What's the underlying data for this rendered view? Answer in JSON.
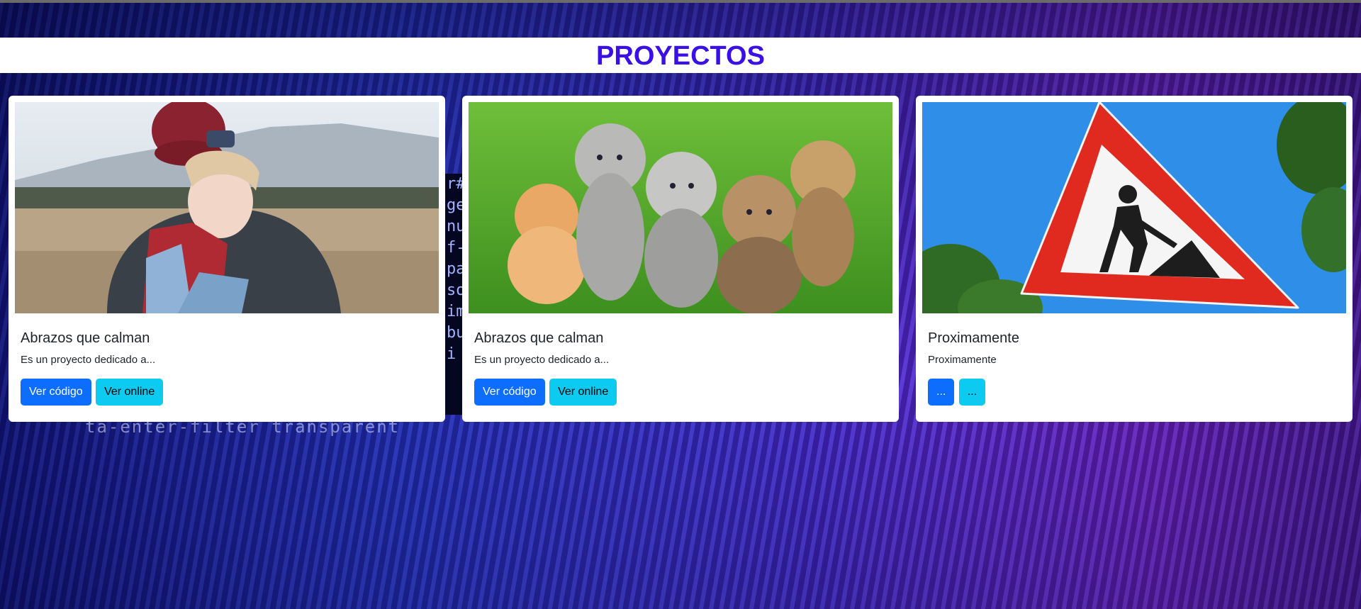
{
  "page": {
    "heading": "PROYECTOS"
  },
  "background": {
    "code_lines": [
      "r#",
      "ge",
      "nu",
      "f-",
      "pa",
      "so",
      "im",
      "bu",
      "i"
    ],
    "blurred_text": "ta-enter-filter transparent"
  },
  "cards": [
    {
      "image": "child-hug-photo",
      "title": "Abrazos que calman",
      "text": "Es un proyecto dedicado a...",
      "buttons": [
        "Ver código",
        "Ver online"
      ]
    },
    {
      "image": "kittens-photo",
      "title": "Abrazos que calman",
      "text": "Es un proyecto dedicado a...",
      "buttons": [
        "Ver código",
        "Ver online"
      ]
    },
    {
      "image": "road-work-sign-photo",
      "title": "Proximamente",
      "text": "Proximamente",
      "buttons": [
        "...",
        "..."
      ]
    }
  ],
  "colors": {
    "heading": "#3b10e6",
    "primary": "#0d6efd",
    "info": "#0dcaf0"
  }
}
